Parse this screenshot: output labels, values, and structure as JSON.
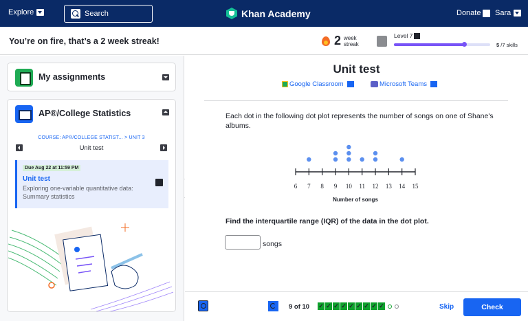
{
  "topbar": {
    "explore_label": "Explore",
    "search_label": "Search",
    "logo_text": "Khan Academy",
    "donate_label": "Donate",
    "user_name": "Sara"
  },
  "streak": {
    "message": "You’re on fire, that’s a 2 week streak!",
    "count": "2",
    "unit_line1": "week",
    "unit_line2": "streak",
    "level_label": "Level 7",
    "skills_done": "5",
    "skills_total": "/7 skills",
    "progress_fraction": 0.73
  },
  "sidebar": {
    "assignments_title": "My assignments",
    "course_title": "AP®/College Statistics",
    "course_breadcrumb": "COURSE: AP®/COLLEGE STATIST...  >  UNIT 3",
    "unit_name": "Unit test",
    "task": {
      "due": "Due Aug 22 at 11:59 PM",
      "title": "Unit test",
      "description": "Exploring one-variable quantitative data: Summary statistics"
    }
  },
  "main": {
    "title": "Unit test",
    "share": {
      "google_classroom": "Google Classroom",
      "microsoft_teams": "Microsoft Teams"
    },
    "question": "Each dot in the following dot plot represents the number of songs on one of Shane's albums.",
    "prompt": "Find the interquartile range (IQR) of the data in the dot plot.",
    "answer_value": "",
    "answer_unit": "songs"
  },
  "chart_data": {
    "type": "scatter",
    "subtype": "dot plot",
    "xlabel": "Number of songs",
    "xlim": [
      6,
      15
    ],
    "ticks": [
      6,
      7,
      8,
      9,
      10,
      11,
      12,
      13,
      14,
      15
    ],
    "counts": {
      "7": 1,
      "9": 2,
      "10": 3,
      "11": 1,
      "12": 2,
      "14": 1
    },
    "dot_color": "#5b8fef"
  },
  "footer": {
    "progress_text": "9 of 10",
    "checks_done": 9,
    "skip_label": "Skip",
    "check_label": "Check"
  },
  "colors": {
    "nav_bg": "#0a2a66",
    "accent": "#1865f2",
    "level_purple": "#7854f7",
    "correct_green": "#0ea12c"
  }
}
